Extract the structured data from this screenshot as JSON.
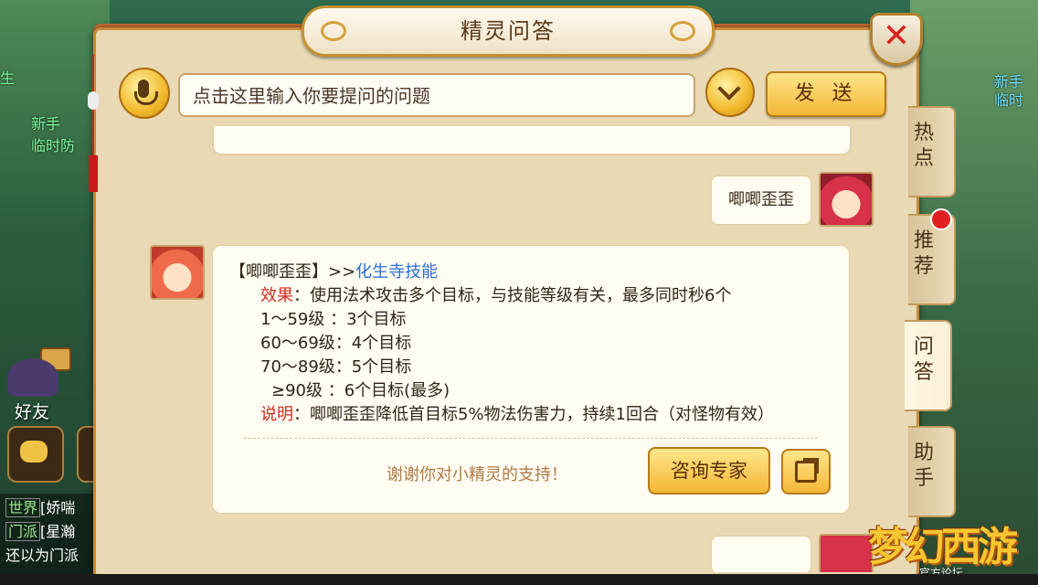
{
  "window": {
    "title": "精灵问答"
  },
  "background": {
    "left_text_1": "生",
    "left_text_2": "新手",
    "left_text_3": "临时防",
    "right_text_1": "新手",
    "right_text_2": "临时",
    "friend_label": "好友",
    "chat_channel_1": "世界",
    "chat_text_1": "[娇喘",
    "chat_channel_2": "门派",
    "chat_text_2": "[星瀚",
    "chat_text_3": "还以为门派"
  },
  "input": {
    "placeholder": "点击这里输入你要提问的问题",
    "send_label": "发 送"
  },
  "conversation": {
    "user_message": "唧唧歪歪",
    "answer": {
      "topic_prefix": "【唧唧歪歪】>>",
      "topic_link": "化生寺技能",
      "effect_label": "效果",
      "effect_text": "：使用法术攻击多个目标，与技能等级有关，最多同时秒6个",
      "rows": [
        "1～59级 ：3个目标",
        "60～69级：4个目标",
        "70～89级：5个目标",
        "≥90级 ：6个目标(最多)"
      ],
      "note_label": "说明",
      "note_text": "：唧唧歪歪降低首目标5%物法伤害力，持续1回合（对怪物有效）",
      "thanks": "谢谢你对小精灵的支持！",
      "expert_button": "咨询专家"
    }
  },
  "side_tabs": [
    {
      "label": "热点"
    },
    {
      "label": "推荐"
    },
    {
      "label": "问答"
    },
    {
      "label": "助手"
    }
  ],
  "logo": {
    "main": "梦幻西游",
    "sub": "官方论坛"
  },
  "colors": {
    "accent": "#f4b736",
    "link": "#2a6fd6",
    "label_red": "#d32a1e",
    "panel": "#e9d9b4"
  }
}
